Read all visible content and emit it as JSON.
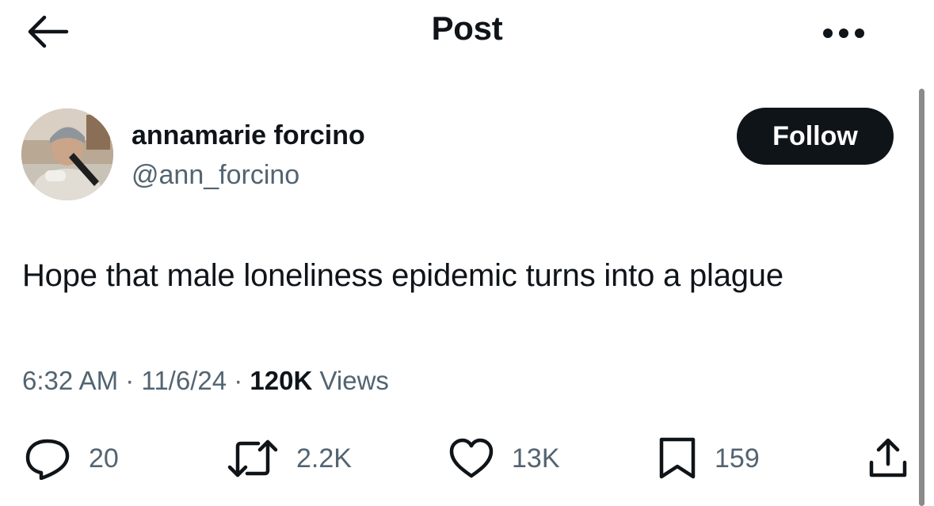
{
  "header": {
    "title": "Post",
    "back_icon": "arrow-left-icon",
    "more_icon": "more-horizontal-icon"
  },
  "author": {
    "name": "annamarie forcino",
    "handle": "@ann_forcino",
    "avatar_icon": "avatar-photo"
  },
  "follow_label": "Follow",
  "post": {
    "text": "Hope that male loneliness epidemic turns into a plague",
    "time": "6:32 AM",
    "separator": "·",
    "date": "11/6/24",
    "views_count": "120K",
    "views_label": "Views"
  },
  "actions": {
    "reply": {
      "icon": "reply-icon",
      "count": "20"
    },
    "repost": {
      "icon": "repost-icon",
      "count": "2.2K"
    },
    "like": {
      "icon": "heart-icon",
      "count": "13K"
    },
    "bookmark": {
      "icon": "bookmark-icon",
      "count": "159"
    },
    "share": {
      "icon": "share-icon"
    }
  },
  "colors": {
    "text_primary": "#0f1419",
    "text_secondary": "#536471",
    "follow_bg": "#0f1419",
    "follow_text": "#ffffff"
  }
}
